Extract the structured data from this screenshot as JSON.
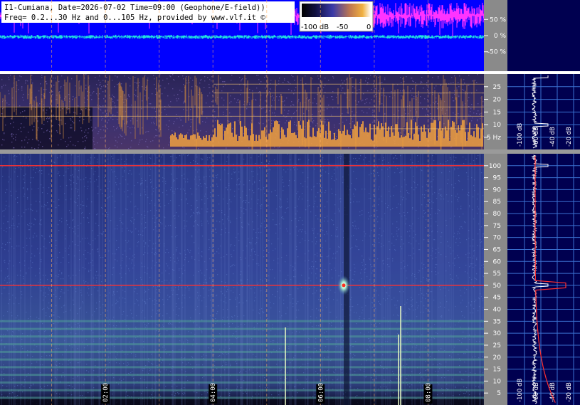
{
  "header": {
    "line1": "I1-Cumiana, Date=2026-07-02 Time=09:00 (Geophone/E-field))",
    "line2": "Freq= 0.2...30 Hz and 0...105 Hz, provided by www.vlf.it ©"
  },
  "colorbar": {
    "labels": [
      "-100 dB",
      "-50",
      "0"
    ]
  },
  "chart_data": [
    {
      "type": "line",
      "panel": "amplitude",
      "ylabel": "",
      "y_ticks": [
        50,
        0,
        -50
      ],
      "y_tick_labels": [
        "50 %",
        "0 %",
        "-50 %"
      ],
      "ylim": [
        -110,
        110
      ],
      "series": [
        {
          "color": "#ff33ff",
          "level": 62
        },
        {
          "color": "#22e0e0",
          "level": -4
        }
      ]
    },
    {
      "type": "heatmap",
      "panel": "spectrogram-low",
      "ylim": [
        0.2,
        30
      ],
      "y_ticks": [
        25,
        20,
        15,
        10,
        5
      ],
      "y_tick_labels": [
        "25",
        "20",
        "15",
        "10",
        "5 Hz"
      ],
      "spectrum_ticks": [
        "-100 dB",
        "-60 dB",
        "-40 dB",
        "-20 dB"
      ]
    },
    {
      "type": "heatmap",
      "panel": "spectrogram-high",
      "ylim": [
        0,
        105
      ],
      "y_ticks": [
        100,
        95,
        90,
        85,
        80,
        75,
        70,
        65,
        60,
        55,
        50,
        45,
        40,
        35,
        30,
        25,
        20,
        15,
        10,
        5
      ],
      "y_tick_labels": [
        "100",
        "95",
        "90",
        "85",
        "80",
        "75",
        "70",
        "65",
        "60",
        "55",
        "50",
        "45",
        "40",
        "35",
        "30",
        "25",
        "20",
        "15",
        "10",
        "5"
      ],
      "x_tick_labels": [
        "02:00",
        "04:00",
        "06:00",
        "08:00"
      ],
      "spectrum_ticks": [
        "-100 dB",
        "-60 dB",
        "-40 dB",
        "-20 dB"
      ],
      "lines_hz": [
        100,
        50
      ]
    }
  ]
}
